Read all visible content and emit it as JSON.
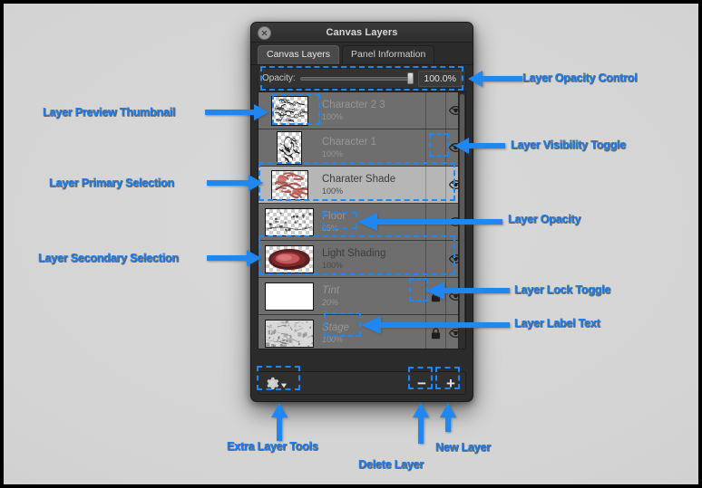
{
  "window": {
    "title": "Canvas Layers",
    "close_icon": "close-circle-icon"
  },
  "tabs": [
    {
      "label": "Canvas Layers",
      "active": true
    },
    {
      "label": "Panel Information",
      "active": false
    }
  ],
  "opacity_control": {
    "label": "Opacity:",
    "value": "100.0%",
    "slider_percent": 100
  },
  "layers": [
    {
      "name": "Character 2 3",
      "opacity": "100%",
      "selected": false,
      "dim": true,
      "italic": false,
      "locked": false,
      "visible": true,
      "thumb": "character23"
    },
    {
      "name": "Character 1",
      "opacity": "100%",
      "selected": false,
      "dim": true,
      "italic": false,
      "locked": false,
      "visible": true,
      "thumb": "character1"
    },
    {
      "name": "Charater Shade",
      "opacity": "100%",
      "selected": true,
      "dim": false,
      "italic": false,
      "locked": false,
      "visible": true,
      "thumb": "charatershade"
    },
    {
      "name": "Floor",
      "opacity": "65%",
      "selected": false,
      "dim": true,
      "italic": false,
      "locked": false,
      "visible": true,
      "thumb": "floor"
    },
    {
      "name": "Light Shading",
      "opacity": "100%",
      "selected": false,
      "dim": false,
      "italic": false,
      "locked": false,
      "visible": true,
      "thumb": "lightshading"
    },
    {
      "name": "Tint",
      "opacity": "20%",
      "selected": false,
      "dim": true,
      "italic": true,
      "locked": true,
      "visible": true,
      "thumb": "tint"
    },
    {
      "name": "Stage",
      "opacity": "100%",
      "selected": false,
      "dim": true,
      "italic": true,
      "locked": true,
      "visible": true,
      "thumb": "stage"
    }
  ],
  "toolbar": {
    "extra_tools_icon": "gear-icon",
    "extra_tools_caret_icon": "caret-down-icon",
    "delete_label": "−",
    "new_label": "+"
  },
  "annotations": [
    {
      "id": "layer-opacity-control",
      "text": "Layer Opacity Control"
    },
    {
      "id": "layer-preview-thumbnail",
      "text": "Layer Preview Thumbnail"
    },
    {
      "id": "layer-visibility-toggle",
      "text": "Layer Visibility Toggle"
    },
    {
      "id": "layer-primary-selection",
      "text": "Layer Primary Selection"
    },
    {
      "id": "layer-opacity",
      "text": "Layer Opacity"
    },
    {
      "id": "layer-secondary-selection",
      "text": "Layer Secondary Selection"
    },
    {
      "id": "layer-lock-toggle",
      "text": "Layer Lock Toggle"
    },
    {
      "id": "layer-label-text",
      "text": "Layer Label Text"
    },
    {
      "id": "extra-layer-tools",
      "text": "Extra Layer Tools"
    },
    {
      "id": "delete-layer",
      "text": "Delete Layer"
    },
    {
      "id": "new-layer",
      "text": "New Layer"
    }
  ],
  "colors": {
    "annotation_blue": "#1a7ef0",
    "panel_bg": "#2b2b2b",
    "row_bg": "#6e6e6e",
    "row_selected_bg": "#b6b6b6",
    "backdrop": "#d4d4d4"
  }
}
